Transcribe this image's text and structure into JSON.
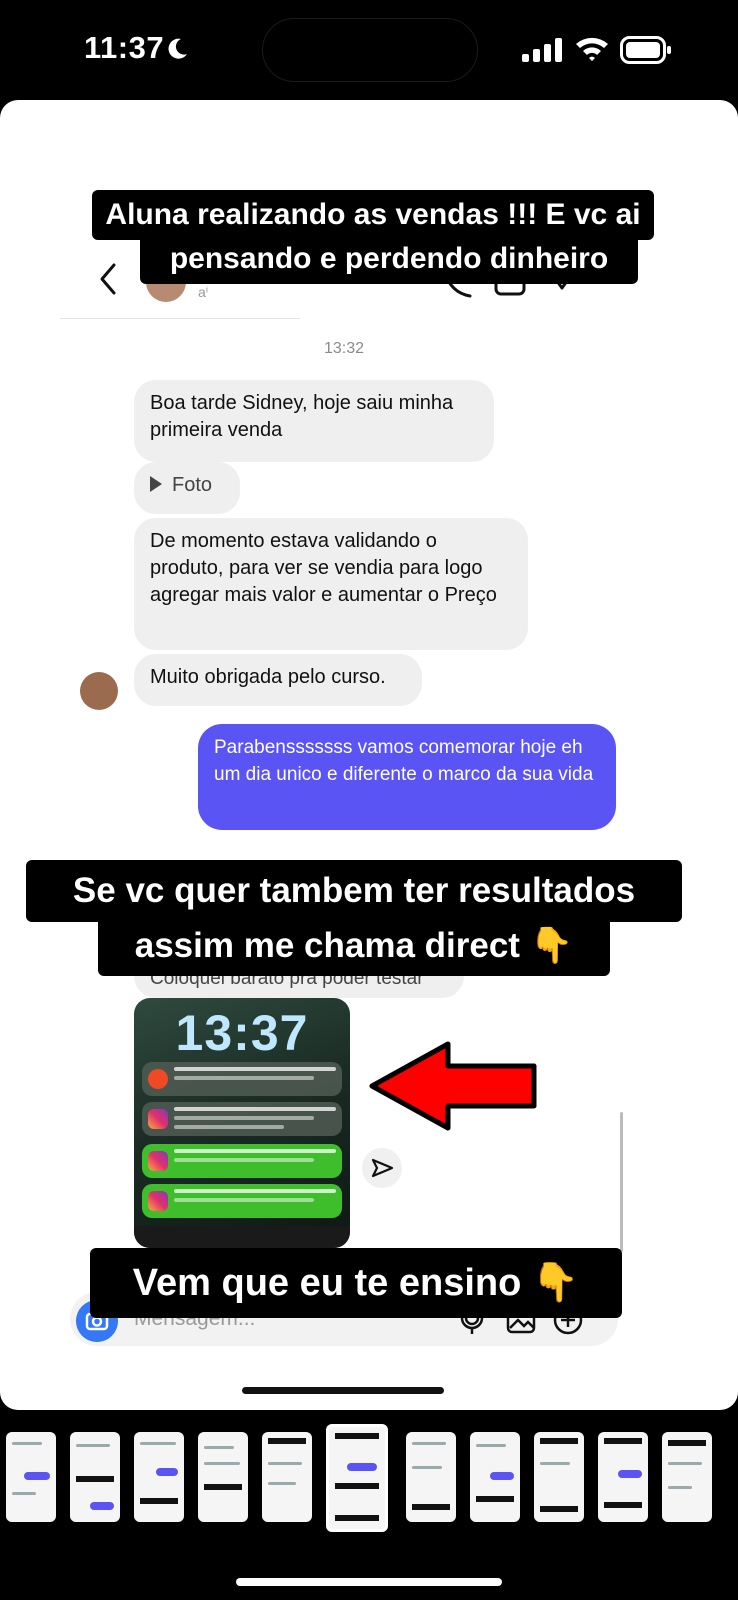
{
  "status_bar": {
    "time": "11:37"
  },
  "captions": {
    "top_line1": "Aluna realizando as vendas !!! E vc ai",
    "top_line2": "pensando e perdendo dinheiro",
    "middle_line1": "Se vc quer tambem ter resultados",
    "middle_line2": "assim me chama direct 👇",
    "bottom": "Vem que eu te ensino 👇"
  },
  "chat": {
    "header_subtitle": "aⁱ",
    "timestamp": "13:32",
    "received": [
      "Boa tarde Sidney, hoje saiu minha primeira venda",
      "Foto",
      "De momento estava validando o produto, para ver se vendia para logo agregar mais valor e aumentar o Preço",
      "Muito obrigada pelo curso."
    ],
    "sent": "Parabensssssss vamos comemorar hoje eh um dia unico e diferente o marco da sua vida",
    "partial_received": "Coloquei barato pra poder testar",
    "screenshot": {
      "lock_time": "13:37",
      "notifications": [
        "hotmart",
        "instagram",
        "instagram",
        "instagram"
      ]
    },
    "composer_placeholder": "Mensagem..."
  },
  "icons": {
    "back": "chevron-left-icon",
    "camera": "camera-icon",
    "mic": "microphone-icon",
    "gallery": "gallery-icon",
    "add": "plus-circle-icon",
    "send": "send-icon",
    "arrow": "red-arrow-icon"
  },
  "colors": {
    "sent_bubble": "#5b54f5",
    "received_bubble": "#efefef",
    "arrow": "#ff0000"
  },
  "thumbnails": {
    "count": 11,
    "active_index": 5
  }
}
